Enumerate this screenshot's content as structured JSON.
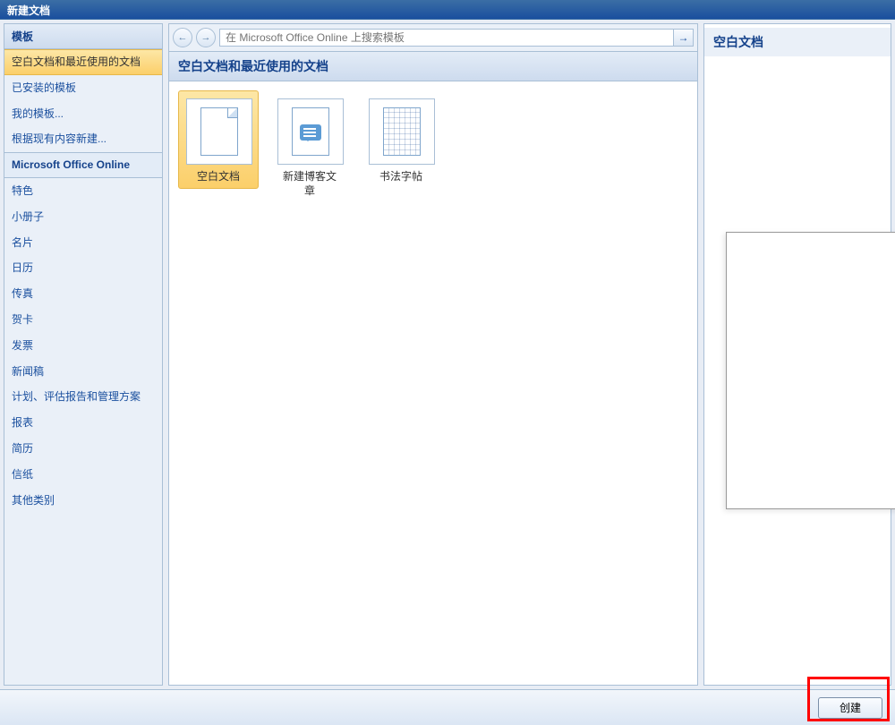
{
  "window": {
    "title": "新建文档"
  },
  "sidebar": {
    "header": "模板",
    "items": [
      {
        "label": "空白文档和最近使用的文档",
        "selected": true
      },
      {
        "label": "已安装的模板"
      },
      {
        "label": "我的模板..."
      },
      {
        "label": "根据现有内容新建..."
      },
      {
        "label": "Microsoft Office Online",
        "section": true
      },
      {
        "label": "特色"
      },
      {
        "label": "小册子"
      },
      {
        "label": "名片"
      },
      {
        "label": "日历"
      },
      {
        "label": "传真"
      },
      {
        "label": "贺卡"
      },
      {
        "label": "发票"
      },
      {
        "label": "新闻稿"
      },
      {
        "label": "计划、评估报告和管理方案"
      },
      {
        "label": "报表"
      },
      {
        "label": "简历"
      },
      {
        "label": "信纸"
      },
      {
        "label": "其他类别"
      }
    ]
  },
  "toolbar": {
    "search_placeholder": "在 Microsoft Office Online 上搜索模板"
  },
  "content": {
    "header": "空白文档和最近使用的文档",
    "templates": [
      {
        "label": "空白文档",
        "icon": "blank",
        "selected": true
      },
      {
        "label": "新建博客文章",
        "icon": "blog"
      },
      {
        "label": "书法字帖",
        "icon": "calligraphy"
      }
    ]
  },
  "preview": {
    "title": "空白文档"
  },
  "footer": {
    "create_label": "创建"
  }
}
